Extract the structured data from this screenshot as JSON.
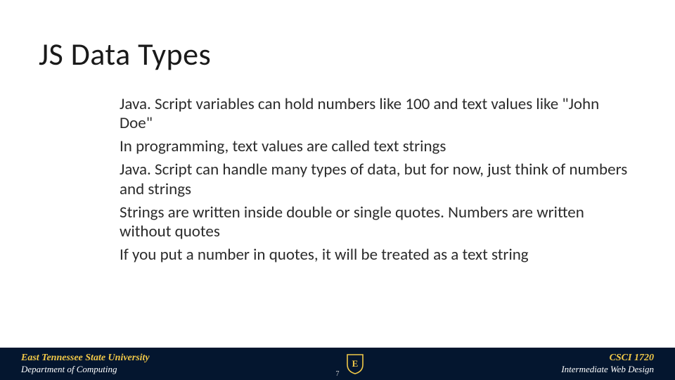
{
  "title": "JS Data Types",
  "body": {
    "p1": "Java. Script variables can hold numbers like 100 and text values like \"John Doe\"",
    "p2": "In programming, text values are called text strings",
    "p3": "Java. Script can handle many types of data, but for now, just think of numbers and strings",
    "p4": "Strings are written inside double or single quotes. Numbers are written without quotes",
    "p5": "If you put a number in quotes, it will be treated as a text string"
  },
  "footer": {
    "left1": "East Tennessee State University",
    "left2": "Department of Computing",
    "right1": "CSCI 1720",
    "right2": "Intermediate Web Design",
    "page": "7",
    "shield_letter": "E"
  },
  "colors": {
    "footer_bg": "#04162f",
    "accent": "#f0c848"
  }
}
